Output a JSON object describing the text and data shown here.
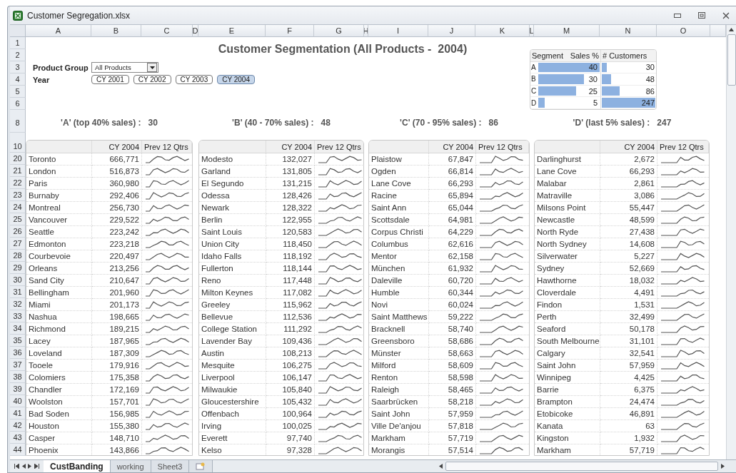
{
  "window": {
    "title": "Customer Segregation.xlsx"
  },
  "column_headers": [
    "A",
    "B",
    "C",
    "D",
    "E",
    "F",
    "G",
    "H",
    "I",
    "J",
    "K",
    "L",
    "M",
    "N",
    "O"
  ],
  "row_headers": [
    "1",
    "2",
    "3",
    "4",
    "5",
    "6",
    "8",
    "10",
    "20",
    "21",
    "22",
    "23",
    "24",
    "25",
    "26",
    "27",
    "28",
    "29",
    "30",
    "31",
    "32",
    "33",
    "34",
    "35",
    "36",
    "37",
    "38",
    "39",
    "40",
    "41",
    "42",
    "43",
    "44"
  ],
  "report": {
    "title": "Customer Segmentation (All Products -  2004)",
    "product_group": {
      "label": "Product Group",
      "value": "All Products"
    },
    "year": {
      "label": "Year",
      "options": [
        {
          "label": "CY 2001",
          "selected": false
        },
        {
          "label": "CY 2002",
          "selected": false
        },
        {
          "label": "CY 2003",
          "selected": false
        },
        {
          "label": "CY 2004",
          "selected": true
        }
      ]
    },
    "summary": {
      "columns": [
        "Segment",
        "Sales %",
        "# Customers"
      ],
      "rows": [
        {
          "segment": "A",
          "sales": {
            "value": "40",
            "level": 1.0
          },
          "customers": {
            "value": "30",
            "level": 0.12
          }
        },
        {
          "segment": "B",
          "sales": {
            "value": "30",
            "level": 0.75
          },
          "customers": {
            "value": "48",
            "level": 0.19
          }
        },
        {
          "segment": "C",
          "sales": {
            "value": "25",
            "level": 0.63
          },
          "customers": {
            "value": "86",
            "level": 0.35
          }
        },
        {
          "segment": "D",
          "sales": {
            "value": "5",
            "level": 0.13
          },
          "customers": {
            "value": "247",
            "level": 1.0
          }
        }
      ]
    },
    "segments": [
      {
        "heading": "'A' (top 40% sales) :",
        "count": "30",
        "columns": [
          "CY 2004",
          "Prev 12 Qtrs"
        ],
        "rows": [
          {
            "name": "Toronto",
            "value": "666,771"
          },
          {
            "name": "London",
            "value": "516,873"
          },
          {
            "name": "Paris",
            "value": "360,980"
          },
          {
            "name": "Burnaby",
            "value": "292,406"
          },
          {
            "name": "Montreal",
            "value": "256,730"
          },
          {
            "name": "Vancouver",
            "value": "229,522"
          },
          {
            "name": "Seattle",
            "value": "223,242"
          },
          {
            "name": "Edmonton",
            "value": "223,218"
          },
          {
            "name": "Courbevoie",
            "value": "220,497"
          },
          {
            "name": "Orleans",
            "value": "213,256"
          },
          {
            "name": "Sand City",
            "value": "210,647"
          },
          {
            "name": "Bellingham",
            "value": "201,960"
          },
          {
            "name": "Miami",
            "value": "201,173"
          },
          {
            "name": "Nashua",
            "value": "198,665"
          },
          {
            "name": "Richmond",
            "value": "189,215"
          },
          {
            "name": "Lacey",
            "value": "187,965"
          },
          {
            "name": "Loveland",
            "value": "187,309"
          },
          {
            "name": "Tooele",
            "value": "179,916"
          },
          {
            "name": "Colomiers",
            "value": "175,358"
          },
          {
            "name": "Chandler",
            "value": "172,169"
          },
          {
            "name": "Woolston",
            "value": "157,701"
          },
          {
            "name": "Bad Soden",
            "value": "156,985"
          },
          {
            "name": "Houston",
            "value": "155,380"
          },
          {
            "name": "Casper",
            "value": "148,710"
          },
          {
            "name": "Phoenix",
            "value": "143,866"
          }
        ]
      },
      {
        "heading": "'B' (40 - 70% sales) :",
        "count": "48",
        "columns": [
          "CY 2004",
          "Prev 12 Qtrs"
        ],
        "rows": [
          {
            "name": "Modesto",
            "value": "132,027"
          },
          {
            "name": "Garland",
            "value": "131,805"
          },
          {
            "name": "El Segundo",
            "value": "131,215"
          },
          {
            "name": "Odessa",
            "value": "128,426"
          },
          {
            "name": "Newark",
            "value": "128,322"
          },
          {
            "name": "Berlin",
            "value": "122,955"
          },
          {
            "name": "Saint Louis",
            "value": "120,583"
          },
          {
            "name": "Union City",
            "value": "118,450"
          },
          {
            "name": "Idaho Falls",
            "value": "118,192"
          },
          {
            "name": "Fullerton",
            "value": "118,144"
          },
          {
            "name": "Reno",
            "value": "117,448"
          },
          {
            "name": "Milton Keynes",
            "value": "117,082"
          },
          {
            "name": "Greeley",
            "value": "115,962"
          },
          {
            "name": "Bellevue",
            "value": "112,536"
          },
          {
            "name": "College Station",
            "value": "111,292"
          },
          {
            "name": "Lavender Bay",
            "value": "109,436"
          },
          {
            "name": "Austin",
            "value": "108,213"
          },
          {
            "name": "Mesquite",
            "value": "106,275"
          },
          {
            "name": "Liverpool",
            "value": "106,147"
          },
          {
            "name": "Milwaukie",
            "value": "105,840"
          },
          {
            "name": "Gloucestershire",
            "value": "105,432"
          },
          {
            "name": "Offenbach",
            "value": "100,964"
          },
          {
            "name": "Irving",
            "value": "100,025"
          },
          {
            "name": "Everett",
            "value": "97,740"
          },
          {
            "name": "Kelso",
            "value": "97,328"
          }
        ]
      },
      {
        "heading": "'C' (70 - 95% sales) :",
        "count": "86",
        "columns": [
          "CY 2004",
          "Prev 12 Qtrs"
        ],
        "rows": [
          {
            "name": "Plaistow",
            "value": "67,847"
          },
          {
            "name": "Ogden",
            "value": "66,814"
          },
          {
            "name": "Lane Cove",
            "value": "66,293"
          },
          {
            "name": "Racine",
            "value": "65,894"
          },
          {
            "name": "Saint Ann",
            "value": "65,044"
          },
          {
            "name": "Scottsdale",
            "value": "64,981"
          },
          {
            "name": "Corpus Christi",
            "value": "64,229"
          },
          {
            "name": "Columbus",
            "value": "62,616"
          },
          {
            "name": "Mentor",
            "value": "62,158"
          },
          {
            "name": "München",
            "value": "61,932"
          },
          {
            "name": "Daleville",
            "value": "60,720"
          },
          {
            "name": "Humble",
            "value": "60,344"
          },
          {
            "name": "Novi",
            "value": "60,024"
          },
          {
            "name": "Saint Matthews",
            "value": "59,222"
          },
          {
            "name": "Bracknell",
            "value": "58,740"
          },
          {
            "name": "Greensboro",
            "value": "58,686"
          },
          {
            "name": "Münster",
            "value": "58,663"
          },
          {
            "name": "Milford",
            "value": "58,609"
          },
          {
            "name": "Renton",
            "value": "58,598"
          },
          {
            "name": "Raleigh",
            "value": "58,465"
          },
          {
            "name": "Saarbrücken",
            "value": "58,218"
          },
          {
            "name": "Saint John",
            "value": "57,959"
          },
          {
            "name": "Ville De'anjou",
            "value": "57,818"
          },
          {
            "name": "Markham",
            "value": "57,719"
          },
          {
            "name": "Morangis",
            "value": "57,514"
          }
        ]
      },
      {
        "heading": "'D' (last 5% sales) :",
        "count": "247",
        "columns": [
          "CY 2004",
          "Prev 12 Qtrs"
        ],
        "rows": [
          {
            "name": "Darlinghurst",
            "value": "2,672"
          },
          {
            "name": "Lane Cove",
            "value": "66,293"
          },
          {
            "name": "Malabar",
            "value": "2,861"
          },
          {
            "name": "Matraville",
            "value": "3,086"
          },
          {
            "name": "Milsons Point",
            "value": "55,447"
          },
          {
            "name": "Newcastle",
            "value": "48,599"
          },
          {
            "name": "North Ryde",
            "value": "27,438"
          },
          {
            "name": "North Sydney",
            "value": "14,608"
          },
          {
            "name": "Silverwater",
            "value": "5,227"
          },
          {
            "name": "Sydney",
            "value": "52,669"
          },
          {
            "name": "Hawthorne",
            "value": "18,032"
          },
          {
            "name": "Cloverdale",
            "value": "4,491"
          },
          {
            "name": "Findon",
            "value": "1,531"
          },
          {
            "name": "Perth",
            "value": "32,499"
          },
          {
            "name": "Seaford",
            "value": "50,178"
          },
          {
            "name": "South Melbourne",
            "value": "31,101"
          },
          {
            "name": "Calgary",
            "value": "32,541"
          },
          {
            "name": "Saint John",
            "value": "57,959"
          },
          {
            "name": "Winnipeg",
            "value": "4,425"
          },
          {
            "name": "Barrie",
            "value": "6,375"
          },
          {
            "name": "Brampton",
            "value": "24,474"
          },
          {
            "name": "Etobicoke",
            "value": "46,891"
          },
          {
            "name": "Kanata",
            "value": "63"
          },
          {
            "name": "Kingston",
            "value": "1,932"
          },
          {
            "name": "Markham",
            "value": "57,719"
          }
        ]
      }
    ]
  },
  "sheet_tabs": [
    {
      "label": "CustBanding",
      "selected": true
    },
    {
      "label": "working",
      "selected": false
    },
    {
      "label": "Sheet3",
      "selected": false
    }
  ]
}
